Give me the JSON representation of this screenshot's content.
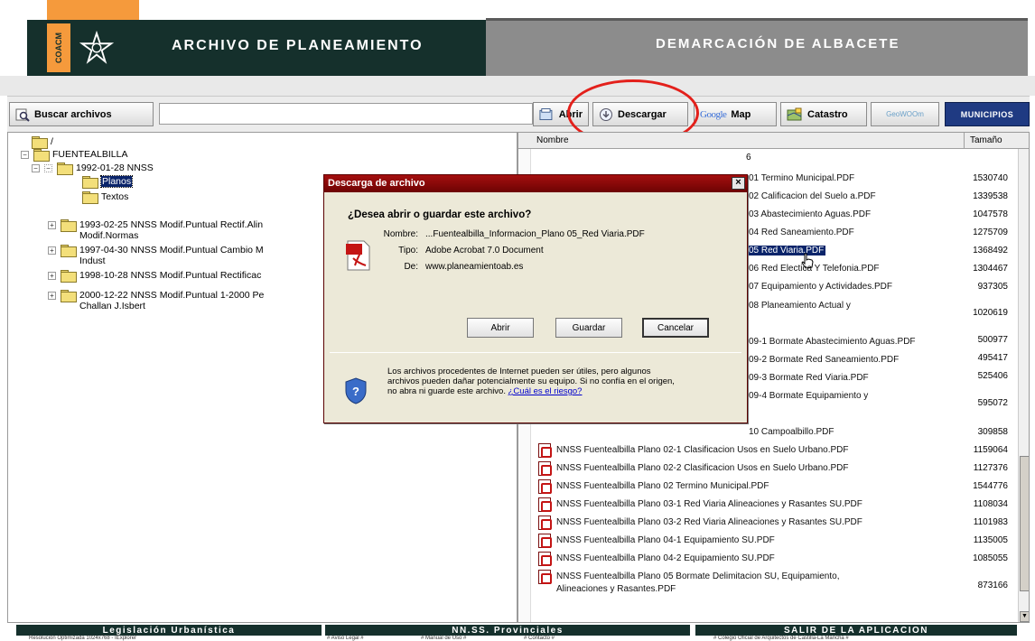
{
  "header": {
    "logo_text": "COACM",
    "left_title": "ARCHIVO DE PLANEAMIENTO",
    "right_title": "DEMARCACIÓN DE ALBACETE",
    "colors": {
      "dark": "#15302c",
      "orange": "#f59a3c",
      "grey": "#8c8c8c"
    }
  },
  "toolbar": {
    "search_label": "Buscar archivos",
    "search_value": "",
    "open_label": "Abrir",
    "download_label": "Descargar",
    "google_logo": "Google",
    "map_label": "Map",
    "cadastre_label": "Catastro",
    "geoweb_label": "GeoWOOm",
    "municipalities_label": "MUNICIPIOS"
  },
  "tree": {
    "root": "/",
    "items": [
      {
        "label": "FUENTEALBILLA"
      },
      {
        "label": "1992-01-28  NNSS"
      },
      {
        "label": "Planos"
      },
      {
        "label": "Textos"
      },
      {
        "label": "1993-02-25  NNSS Modif.Puntual Rectif.Alin",
        "label2": "Modif.Normas"
      },
      {
        "label": "1997-04-30  NNSS Modif.Puntual Cambio M",
        "label2": "Indust"
      },
      {
        "label": "1998-10-28  NNSS Modif.Puntual Rectificac"
      },
      {
        "label": "2000-12-22  NNSS Modif.Puntual 1-2000 Pe",
        "label2": "Challan J.Isbert"
      }
    ]
  },
  "file_list": {
    "col_name": "Nombre",
    "col_size": "Tamaño",
    "partial_header": "6",
    "rows": [
      {
        "name": "01 Termino Municipal.PDF",
        "size": "1530740"
      },
      {
        "name": "02 Calificacion del Suelo a.PDF",
        "size": "1339538"
      },
      {
        "name": "03 Abastecimiento Aguas.PDF",
        "size": "1047578"
      },
      {
        "name": "04 Red Saneamiento.PDF",
        "size": "1275709"
      },
      {
        "name": "05 Red Viaria.PDF",
        "size": "1368492",
        "selected": true
      },
      {
        "name": "06 Red Electica Y Telefonia.PDF",
        "size": "1304467"
      },
      {
        "name": "07 Equipamiento y Actividades.PDF",
        "size": "937305"
      },
      {
        "name": "08 Planeamiento Actual y",
        "size": "1020619"
      },
      {
        "name": "09-1 Bormate Abastecimiento Aguas.PDF",
        "size": "500977"
      },
      {
        "name": "09-2 Bormate Red Saneamiento.PDF",
        "size": "495417"
      },
      {
        "name": "09-3 Bormate Red Viaria.PDF",
        "size": "525406"
      },
      {
        "name": "09-4 Bormate Equipamiento y",
        "size": "595072"
      },
      {
        "name": "10 Campoalbillo.PDF",
        "size": "309858"
      },
      {
        "name": "NNSS Fuentealbilla Plano 02-1 Clasificacion Usos en Suelo Urbano.PDF",
        "size": "1159064"
      },
      {
        "name": "NNSS Fuentealbilla Plano 02-2 Clasificacion Usos en Suelo Urbano.PDF",
        "size": "1127376"
      },
      {
        "name": "NNSS Fuentealbilla Plano 02 Termino Municipal.PDF",
        "size": "1544776"
      },
      {
        "name": "NNSS Fuentealbilla Plano 03-1 Red Viaria Alineaciones y Rasantes SU.PDF",
        "size": "1108034"
      },
      {
        "name": "NNSS Fuentealbilla Plano 03-2 Red Viaria Alineaciones y Rasantes SU.PDF",
        "size": "1101983"
      },
      {
        "name": "NNSS Fuentealbilla Plano 04-1 Equipamiento SU.PDF",
        "size": "1135005"
      },
      {
        "name": "NNSS Fuentealbilla Plano 04-2 Equipamiento SU.PDF",
        "size": "1085055"
      },
      {
        "name": "NNSS Fuentealbilla Plano 05 Bormate Delimitacion SU, Equipamiento,",
        "name2": "Alineaciones y Rasantes.PDF",
        "size": "873166"
      }
    ]
  },
  "dialog": {
    "title": "Descarga de archivo",
    "close": "×",
    "question": "¿Desea abrir o guardar este archivo?",
    "name_label": "Nombre:",
    "name_value": "...Fuentealbilla_Informacion_Plano 05_Red Viaria.PDF",
    "type_label": "Tipo:",
    "type_value": "Adobe Acrobat 7.0 Document",
    "from_label": "De:",
    "from_value": "www.planeamientoab.es",
    "open_button": "Abrir",
    "save_button": "Guardar",
    "cancel_button": "Cancelar",
    "warning_text": "Los archivos procedentes de Internet pueden ser útiles, pero algunos archivos pueden dañar potencialmente su equipo. Si no confía en el origen, no abra ni guarde este archivo.",
    "risk_link": "¿Cuál es el riesgo?"
  },
  "footer": {
    "tabs": [
      "Legislación  Urbanística",
      "NN.SS.  Provinciales",
      "SALIR  DE  LA  APLICACION"
    ],
    "links": [
      "Resolución Optimizada 1024x768 - IExplorer",
      "# Aviso Legal #",
      "# Manual de Uso #",
      "# Contacto #",
      "# Colegio Oficial de Arquitectos de Castilla-La Mancha #"
    ]
  }
}
